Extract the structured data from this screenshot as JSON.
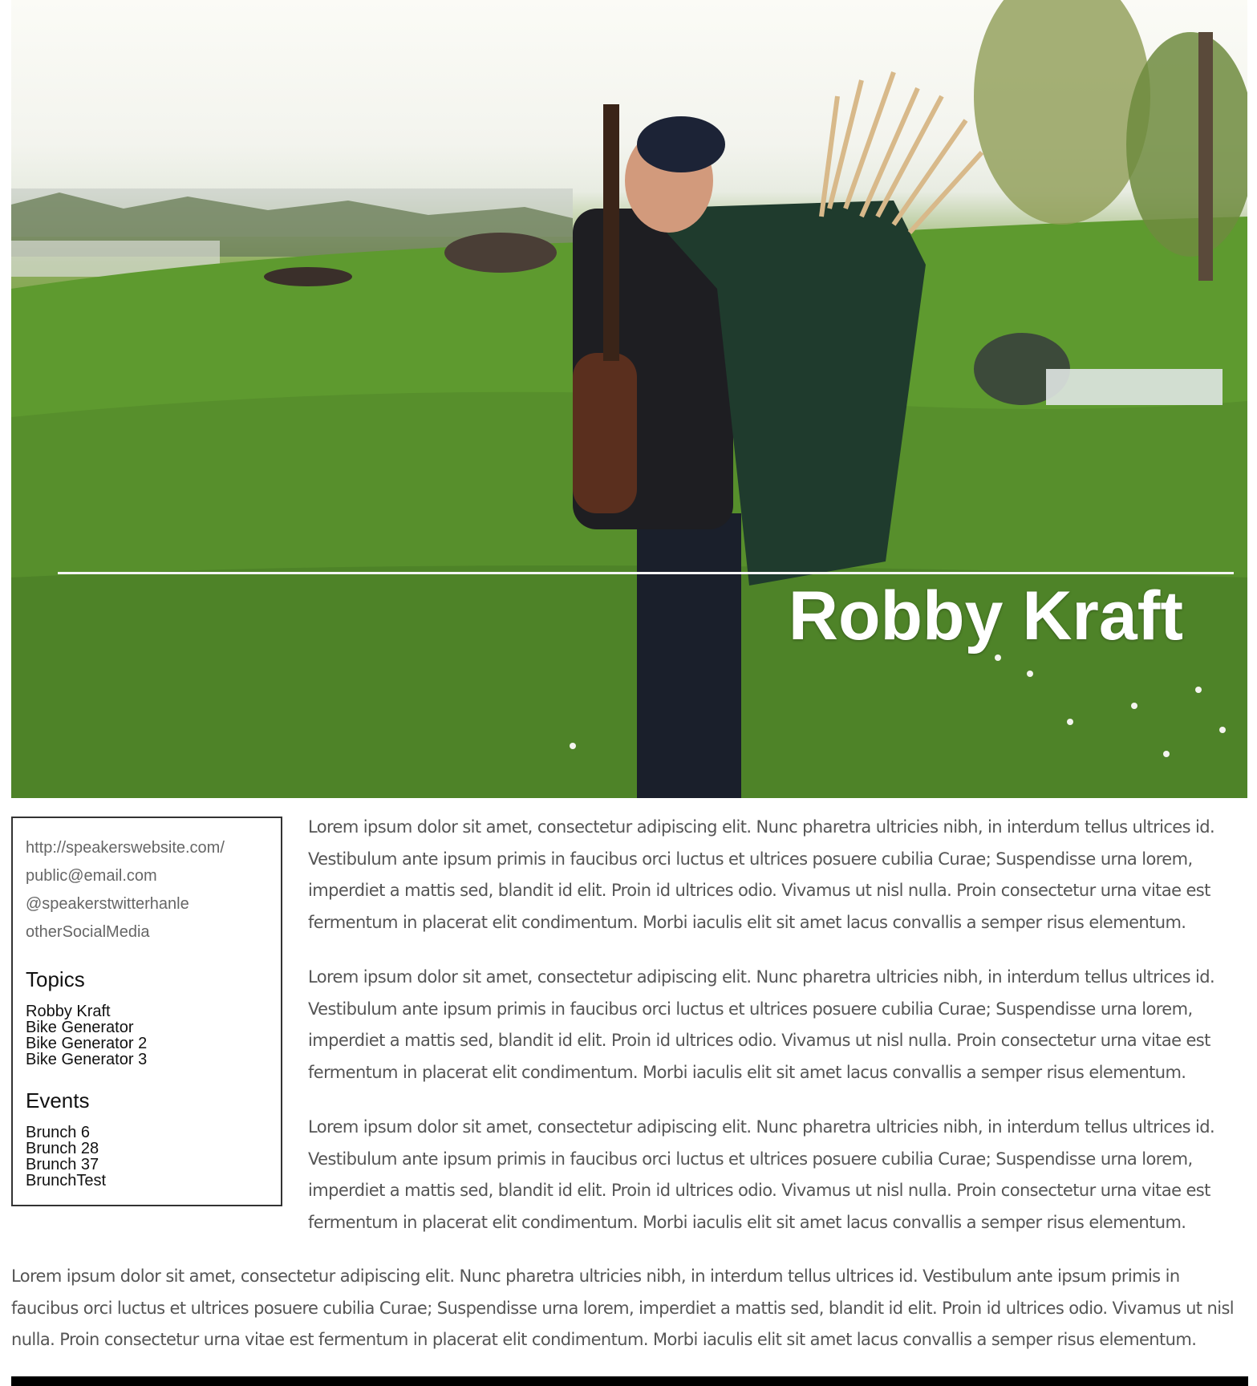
{
  "hero": {
    "name": "Robby Kraft",
    "image_alt": "Robby Kraft standing on a grassy hill with a guitar and a large green backpack"
  },
  "sidebar": {
    "contact": {
      "website": "http://speakerswebsite.com/",
      "email": "public@email.com",
      "twitter": "@speakerstwitterhanle",
      "other": "otherSocialMedia"
    },
    "topics_heading": "Topics",
    "topics": [
      "Robby Kraft",
      "Bike Generator",
      "Bike Generator 2",
      "Bike Generator 3"
    ],
    "events_heading": "Events",
    "events": [
      "Brunch 6",
      "Brunch 28",
      "Brunch 37",
      "BrunchTest"
    ]
  },
  "main": {
    "paragraphs": [
      "Lorem ipsum dolor sit amet, consectetur adipiscing elit. Nunc pharetra ultricies nibh, in interdum tellus ultrices id. Vestibulum ante ipsum primis in faucibus orci luctus et ultrices posuere cubilia Curae; Suspendisse urna lorem, imperdiet a mattis sed, blandit id elit. Proin id ultrices odio. Vivamus ut nisl nulla. Proin consectetur urna vitae est fermentum in placerat elit condimentum. Morbi iaculis elit sit amet lacus convallis a semper risus elementum.",
      "Lorem ipsum dolor sit amet, consectetur adipiscing elit. Nunc pharetra ultricies nibh, in interdum tellus ultrices id. Vestibulum ante ipsum primis in faucibus orci luctus et ultrices posuere cubilia Curae; Suspendisse urna lorem, imperdiet a mattis sed, blandit id elit. Proin id ultrices odio. Vivamus ut nisl nulla. Proin consectetur urna vitae est fermentum in placerat elit condimentum. Morbi iaculis elit sit amet lacus convallis a semper risus elementum.",
      "Lorem ipsum dolor sit amet, consectetur adipiscing elit. Nunc pharetra ultricies nibh, in interdum tellus ultrices id. Vestibulum ante ipsum primis in faucibus orci luctus et ultrices posuere cubilia Curae; Suspendisse urna lorem, imperdiet a mattis sed, blandit id elit. Proin id ultrices odio. Vivamus ut nisl nulla. Proin consectetur urna vitae est fermentum in placerat elit condimentum. Morbi iaculis elit sit amet lacus convallis a semper risus elementum."
    ],
    "wide_paragraph": "Lorem ipsum dolor sit amet, consectetur adipiscing elit. Nunc pharetra ultricies nibh, in interdum tellus ultrices id. Vestibulum ante ipsum primis in faucibus orci luctus et ultrices posuere cubilia Curae; Suspendisse urna lorem, imperdiet a mattis sed, blandit id elit. Proin id ultrices odio. Vivamus ut nisl nulla. Proin consectetur urna vitae est fermentum in placerat elit condimentum. Morbi iaculis elit sit amet lacus convallis a semper risus elementum."
  },
  "colors": {
    "grass": "#5f8f30",
    "sky": "#fbfbf6",
    "body_text": "#555555",
    "contact_text": "#666666",
    "footer": "#000000"
  }
}
